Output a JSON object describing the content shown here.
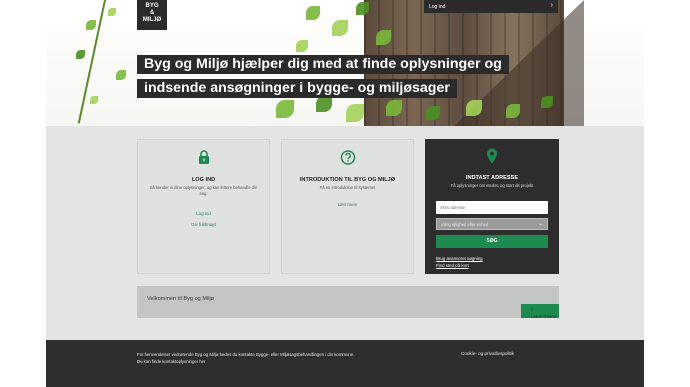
{
  "header": {
    "logo_line1": "BYG",
    "logo_line2": "&",
    "logo_line3": "MILJØ",
    "login_label": "Log ind",
    "headline_line1": "Byg og Miljø hjælper dig med at finde oplysninger og",
    "headline_line2": "indsende ansøgninger i bygge- og miljøsager"
  },
  "cards": {
    "login": {
      "icon": "lock-icon",
      "title": "LOG IND",
      "description": "Så kender vi dine oplysninger, og kan lettere behandle din sag.",
      "link1": "Log ind",
      "link2": "Giv fuldmagt"
    },
    "intro": {
      "icon": "question-icon",
      "title": "INTRODUKTION TIL BYG OG MILJØ",
      "description": "Få en introduktion til systemet",
      "link": "Læs mere"
    },
    "address": {
      "icon": "location-pin-icon",
      "title": "INDTAST ADRESSE",
      "description": "Få oplysninger om stedet, og start dit projekt",
      "input_placeholder": "Skriv adresse",
      "select_value": "Vælg ejlighed eller enhed",
      "search_label": "SØG",
      "advanced_link": "Brug avanceret søgning",
      "map_link": "Find sted på kort"
    }
  },
  "welcome": {
    "text": "Velkommen til Byg og Miljø",
    "read_more": "Læs mere"
  },
  "footer": {
    "line1": "For henvendelser vedrørende Byg og Miljø bedes du kontakte Bygge- eller Miljøsagsbehandlingen i din kommune.",
    "line2": "Du kan finde kontaktoplysninger her",
    "privacy": "Cookie- og privatlivspolitik"
  },
  "colors": {
    "accent_green": "#1d8a4f",
    "dark": "#2b2b2b",
    "panel_gray": "#e3e4e3"
  }
}
